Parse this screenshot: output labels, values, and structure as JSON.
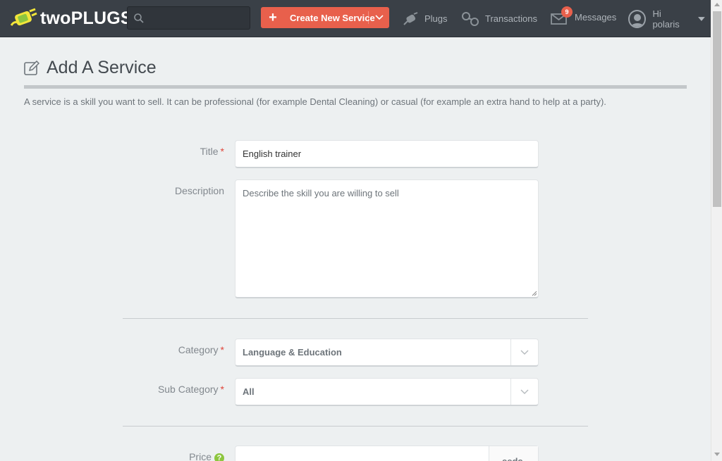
{
  "header": {
    "logo_text": "twoPLUGS",
    "search_placeholder": "",
    "create_label": "Create New Service",
    "nav": {
      "plugs": "Plugs",
      "transactions": "Transactions",
      "messages": "Messages",
      "messages_count": "9",
      "user": "Hi polaris"
    }
  },
  "page": {
    "title": "Add A Service",
    "intro": "A service is a skill you want to sell. It can be professional (for example Dental Cleaning) or casual (for example an extra hand to help at a party)."
  },
  "form": {
    "title_label": "Title",
    "title_value": "English trainer",
    "description_label": "Description",
    "description_placeholder": "Describe the skill you are willing to sell",
    "category_label": "Category",
    "category_value": "Language & Education",
    "subcategory_label": "Sub Category",
    "subcategory_value": "All",
    "price_label": "Price",
    "price_help": "?",
    "price_addon": "eeds",
    "required_mark": "*"
  },
  "colors": {
    "topbar": "#3a4047",
    "accent": "#e8604c",
    "required": "#e0453a",
    "help": "#8dc63f"
  }
}
